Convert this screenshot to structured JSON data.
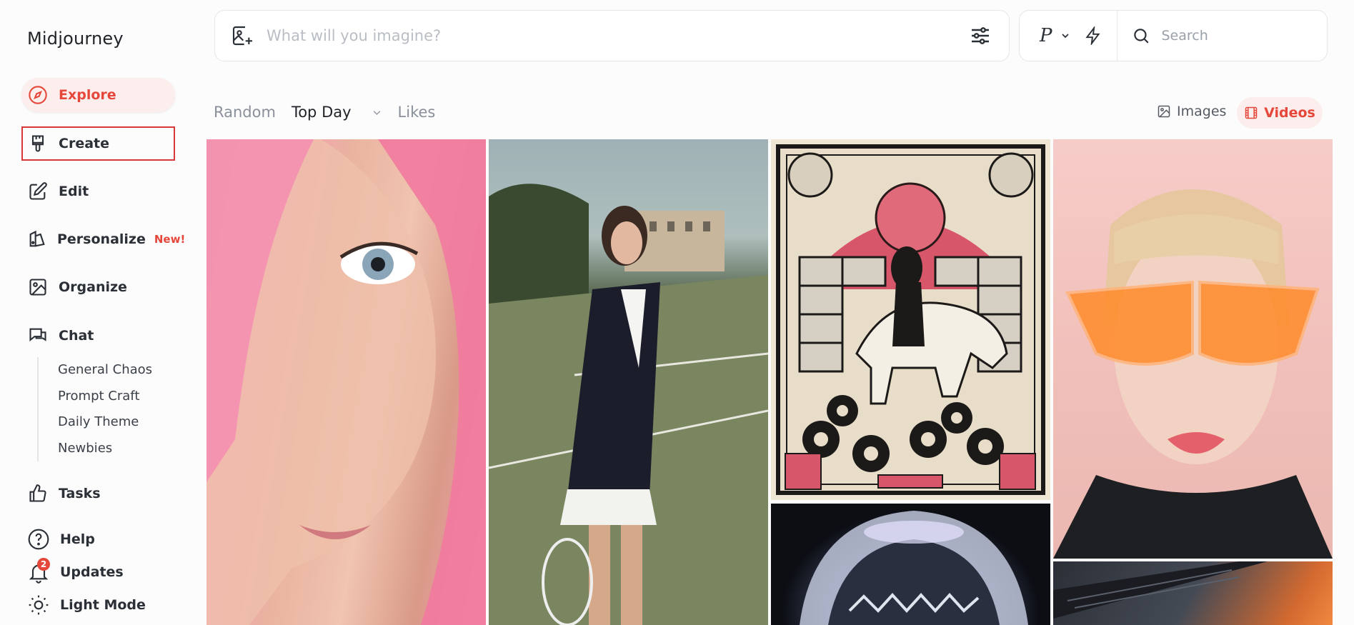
{
  "app": {
    "logo": "Midjourney"
  },
  "nav": {
    "explore": "Explore",
    "create": "Create",
    "edit": "Edit",
    "personalize": "Personalize",
    "personalize_badge": "New!",
    "organize": "Organize",
    "chat": "Chat",
    "chat_rooms": [
      "General Chaos",
      "Prompt Craft",
      "Daily Theme",
      "Newbies"
    ],
    "tasks": "Tasks",
    "help": "Help",
    "updates": "Updates",
    "updates_count": "2",
    "light_mode": "Light Mode"
  },
  "prompt": {
    "placeholder": "What will you imagine?"
  },
  "toolbar": {
    "personalization_letter": "P"
  },
  "search": {
    "placeholder": "Search"
  },
  "filters": {
    "random": "Random",
    "top_day": "Top Day",
    "likes": "Likes"
  },
  "media_toggle": {
    "images": "Images",
    "videos": "Videos",
    "selected": "Videos"
  },
  "colors": {
    "accent": "#e5483a",
    "accent_bg": "#fdeeee",
    "highlight_border": "#d93838"
  }
}
